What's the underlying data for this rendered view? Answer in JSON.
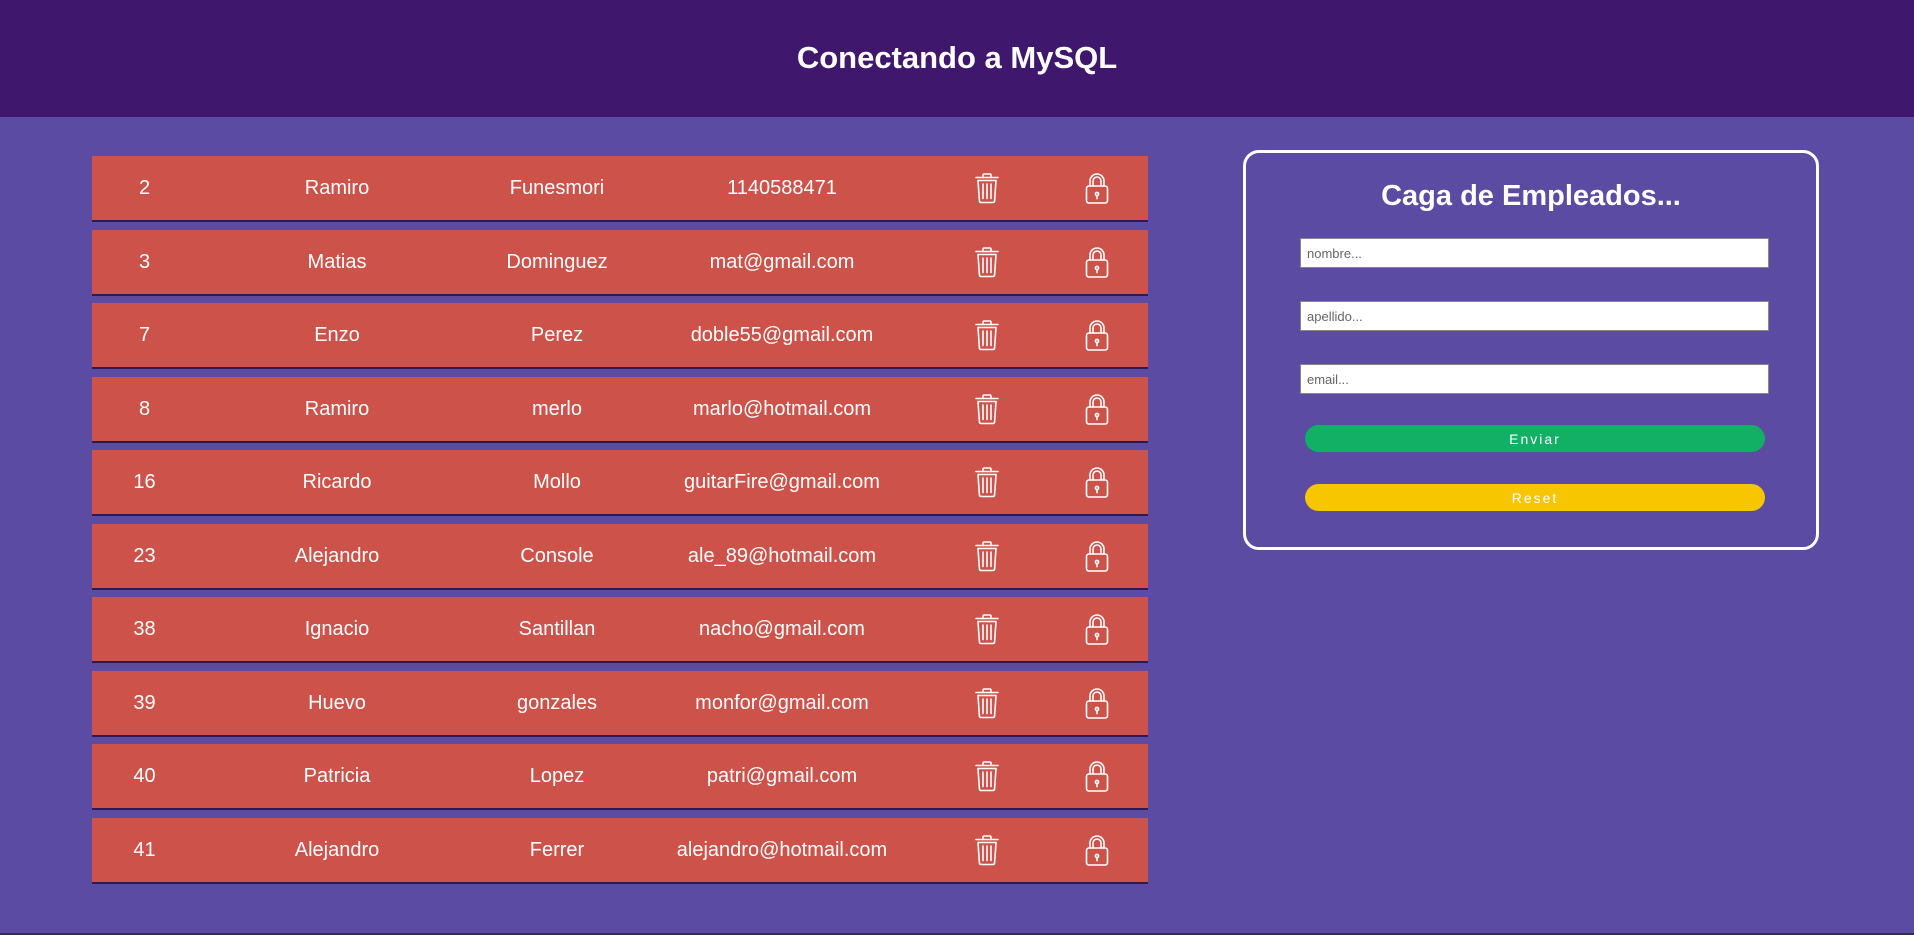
{
  "header": {
    "title": "Conectando a MySQL"
  },
  "colors": {
    "background": "#5b4ba3",
    "header": "#3f176c",
    "row": "#cd534a",
    "send": "#11b064",
    "reset": "#f7c600"
  },
  "rows": [
    {
      "id": "2",
      "nombre": "Ramiro",
      "apellido": "Funesmori",
      "email": "1140588471"
    },
    {
      "id": "3",
      "nombre": "Matias",
      "apellido": "Dominguez",
      "email": "mat@gmail.com"
    },
    {
      "id": "7",
      "nombre": "Enzo",
      "apellido": "Perez",
      "email": "doble55@gmail.com"
    },
    {
      "id": "8",
      "nombre": "Ramiro",
      "apellido": "merlo",
      "email": "marlo@hotmail.com"
    },
    {
      "id": "16",
      "nombre": "Ricardo",
      "apellido": "Mollo",
      "email": "guitarFire@gmail.com"
    },
    {
      "id": "23",
      "nombre": "Alejandro",
      "apellido": "Console",
      "email": "ale_89@hotmail.com"
    },
    {
      "id": "38",
      "nombre": "Ignacio",
      "apellido": "Santillan",
      "email": "nacho@gmail.com"
    },
    {
      "id": "39",
      "nombre": "Huevo",
      "apellido": "gonzales",
      "email": "monfor@gmail.com"
    },
    {
      "id": "40",
      "nombre": "Patricia",
      "apellido": "Lopez",
      "email": "patri@gmail.com"
    },
    {
      "id": "41",
      "nombre": "Alejandro",
      "apellido": "Ferrer",
      "email": "alejandro@hotmail.com"
    }
  ],
  "row_icons": {
    "delete": "trash-icon",
    "edit": "lock-icon"
  },
  "form": {
    "title": "Caga de Empleados...",
    "nombre_placeholder": "nombre...",
    "apellido_placeholder": "apellido...",
    "email_placeholder": "email...",
    "send_label": "Enviar",
    "reset_label": "Reset"
  }
}
